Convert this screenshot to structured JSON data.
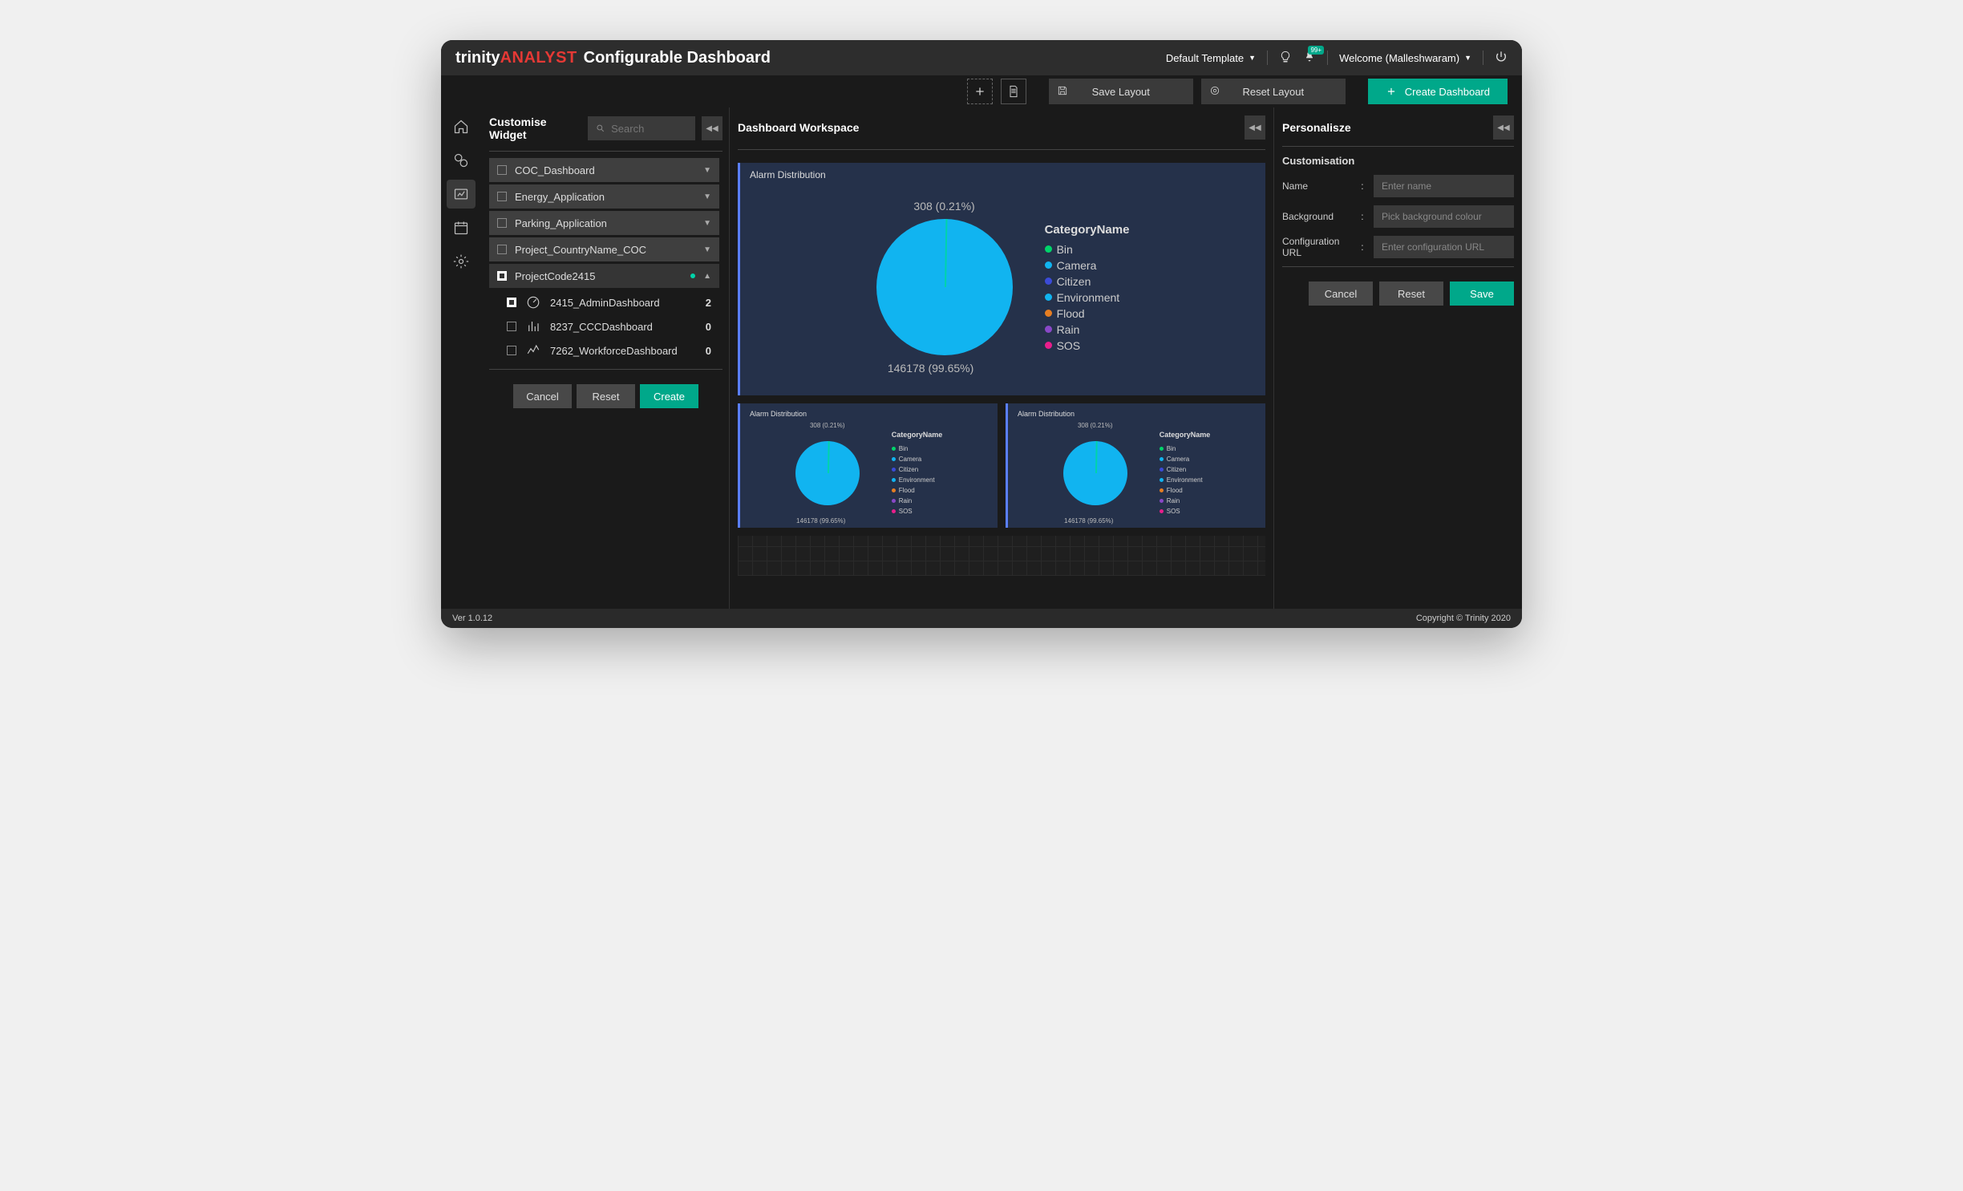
{
  "header": {
    "logo_part1": "trinity",
    "logo_part2": "ANALYST",
    "page_title": "Configurable Dashboard",
    "template_label": "Default Template",
    "notif_count": "99+",
    "welcome_label": "Welcome (Malleshwaram)"
  },
  "toolbar": {
    "save_layout": "Save Layout",
    "reset_layout": "Reset Layout",
    "create_dashboard": "Create Dashboard"
  },
  "left": {
    "title": "Customise Widget",
    "search_placeholder": "Search",
    "categories": [
      {
        "label": "COC_Dashboard"
      },
      {
        "label": "Energy_Application"
      },
      {
        "label": "Parking_Application"
      },
      {
        "label": "Project_CountryName_COC"
      },
      {
        "label": "ProjectCode2415",
        "expanded": true
      }
    ],
    "sub_items": [
      {
        "label": "2415_AdminDashboard",
        "count": "2",
        "checked": true,
        "icon": "gauge"
      },
      {
        "label": "8237_CCCDashboard",
        "count": "0",
        "checked": false,
        "icon": "bars"
      },
      {
        "label": "7262_WorkforceDashboard",
        "count": "0",
        "checked": false,
        "icon": "line"
      }
    ],
    "cancel": "Cancel",
    "reset": "Reset",
    "create": "Create"
  },
  "center": {
    "title": "Dashboard Workspace",
    "widget_title": "Alarm Distribution"
  },
  "right": {
    "title": "Personalisze",
    "section": "Customisation",
    "name_label": "Name",
    "name_placeholder": "Enter name",
    "bg_label": "Background",
    "bg_placeholder": "Pick background colour",
    "url_label": "Configuration URL",
    "url_placeholder": "Enter configuration URL",
    "cancel": "Cancel",
    "reset": "Reset",
    "save": "Save"
  },
  "footer": {
    "version": "Ver 1.0.12",
    "copyright": "Copyright © Trinity 2020"
  },
  "chart_data": {
    "type": "pie",
    "title": "Alarm Distribution",
    "label_top": "308 (0.21%)",
    "label_bottom": "146178 (99.65%)",
    "legend_title": "CategoryName",
    "series": [
      {
        "name": "Bin",
        "color": "#00d46a"
      },
      {
        "name": "Camera",
        "color": "#11b4f0"
      },
      {
        "name": "Citizen",
        "color": "#3b4bd8"
      },
      {
        "name": "Environment",
        "color": "#11b4f0"
      },
      {
        "name": "Flood",
        "color": "#e67e22"
      },
      {
        "name": "Rain",
        "color": "#8948c7"
      },
      {
        "name": "SOS",
        "color": "#e91e8c"
      }
    ],
    "values": [
      {
        "label": "146178",
        "pct": 99.65
      },
      {
        "label": "308",
        "pct": 0.21
      }
    ]
  }
}
